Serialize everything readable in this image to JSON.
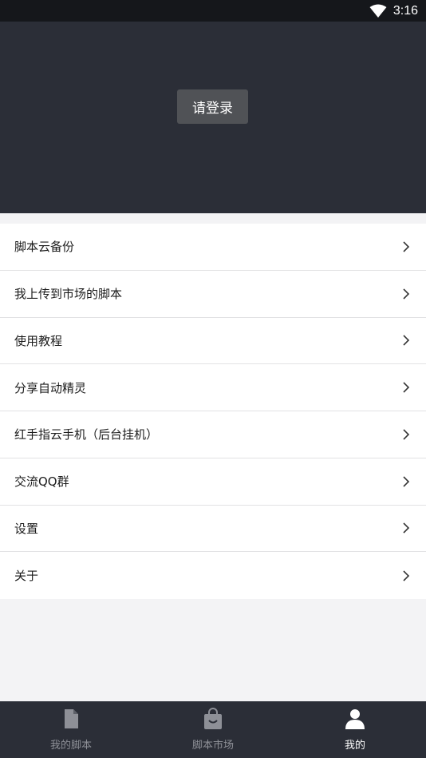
{
  "status_bar": {
    "time": "3:16",
    "wifi_icon": "wifi-icon"
  },
  "header": {
    "login_label": "请登录"
  },
  "menu": {
    "items": [
      {
        "label": "脚本云备份",
        "icon": "chevron-right-icon"
      },
      {
        "label": "我上传到市场的脚本",
        "icon": "chevron-right-icon"
      },
      {
        "label": "使用教程",
        "icon": "chevron-right-icon"
      },
      {
        "label": "分享自动精灵",
        "icon": "chevron-right-icon"
      },
      {
        "label": "红手指云手机（后台挂机）",
        "icon": "chevron-right-icon"
      },
      {
        "label": "交流QQ群",
        "icon": "chevron-right-icon"
      },
      {
        "label": "设置",
        "icon": "chevron-right-icon"
      },
      {
        "label": "关于",
        "icon": "chevron-right-icon"
      }
    ]
  },
  "bottom_nav": {
    "items": [
      {
        "label": "我的脚本",
        "icon": "document-icon",
        "active": false
      },
      {
        "label": "脚本市场",
        "icon": "shopping-bag-icon",
        "active": false
      },
      {
        "label": "我的",
        "icon": "person-icon",
        "active": true
      }
    ]
  },
  "colors": {
    "header_bg": "#2b2e37",
    "status_bar_bg": "#15171b",
    "page_bg": "#f3f3f5",
    "inactive_nav": "#8e9097",
    "active_nav": "#ffffff"
  }
}
